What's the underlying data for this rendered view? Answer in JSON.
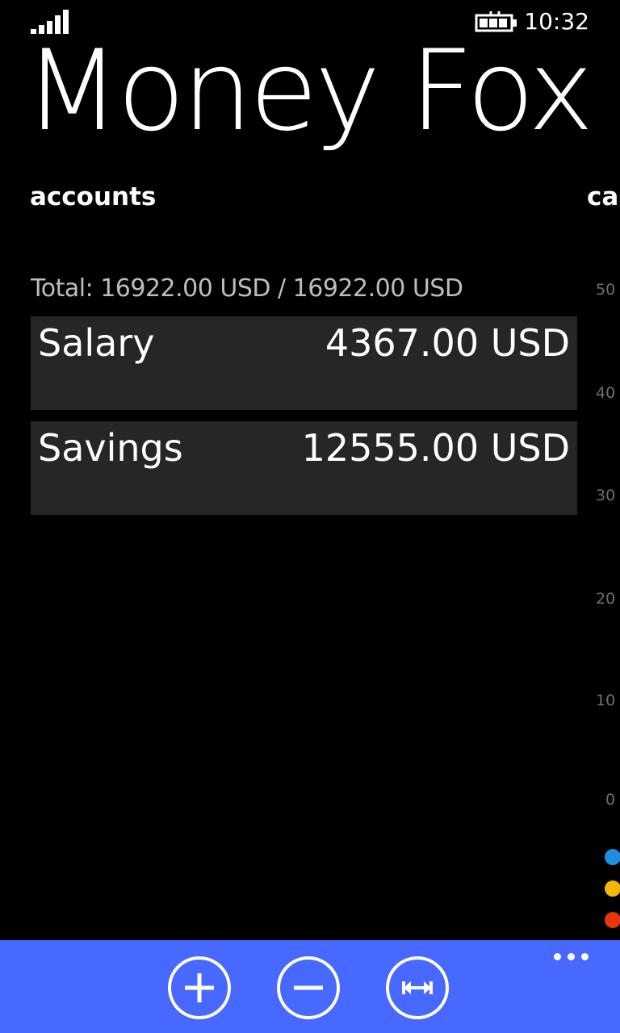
{
  "status_bar": {
    "time": "10:32",
    "signal_icon": "signal-bars-icon",
    "battery_icon": "battery-charging-icon"
  },
  "app": {
    "title": "Money Fox"
  },
  "pivot": {
    "current": "accounts",
    "next_peek": "cas"
  },
  "accounts": {
    "total": "Total: 16922.00 USD / 16922.00 USD",
    "items": [
      {
        "name": "Salary",
        "balance": "4367.00 USD"
      },
      {
        "name": "Savings",
        "balance": "12555.00 USD"
      }
    ]
  },
  "chart_peek": {
    "tick_labels": [
      "50",
      "40",
      "30",
      "20",
      "10",
      "0"
    ],
    "legend_colors": [
      "#1e8fe0",
      "#f2b70f",
      "#e8360c"
    ]
  },
  "app_bar": {
    "buttons": [
      {
        "icon": "add-icon"
      },
      {
        "icon": "remove-icon"
      },
      {
        "icon": "transfer-icon"
      }
    ],
    "more_icon": "ellipsis-icon",
    "background": "#4769ff"
  }
}
